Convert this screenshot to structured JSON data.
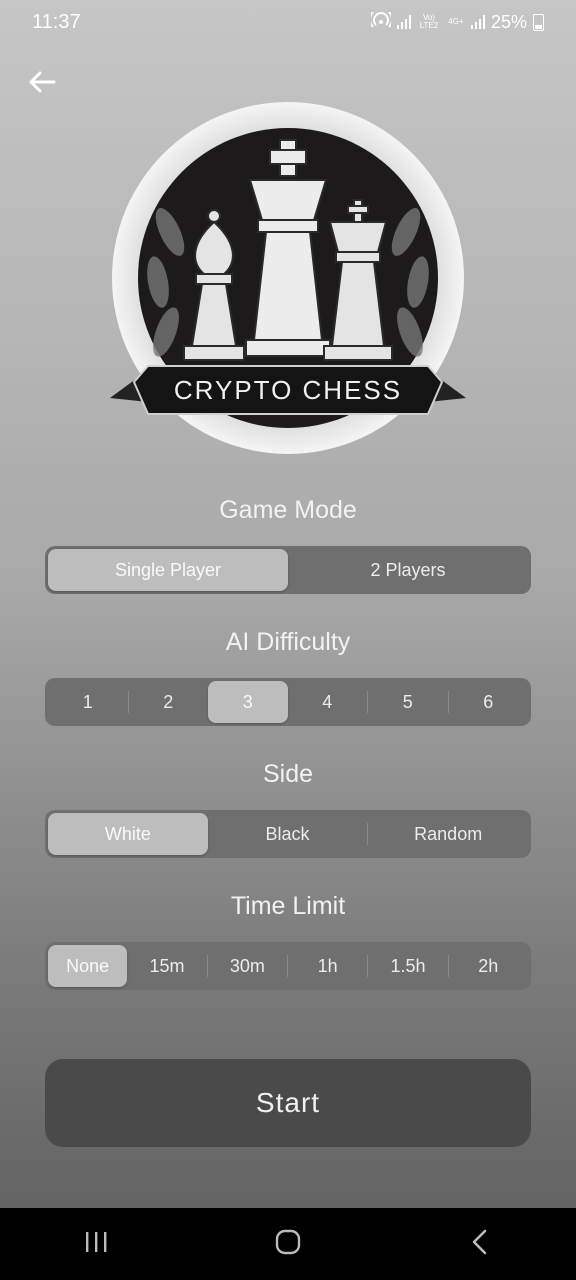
{
  "status_bar": {
    "time": "11:37",
    "network_lte": "Vo) LTE2",
    "network_4g": "4G+",
    "battery": "25%"
  },
  "logo": {
    "text": "CRYPTO CHESS"
  },
  "game_mode": {
    "title": "Game Mode",
    "options": [
      "Single Player",
      "2 Players"
    ],
    "selected": "Single Player"
  },
  "ai_difficulty": {
    "title": "AI Difficulty",
    "options": [
      "1",
      "2",
      "3",
      "4",
      "5",
      "6"
    ],
    "selected": "3"
  },
  "side": {
    "title": "Side",
    "options": [
      "White",
      "Black",
      "Random"
    ],
    "selected": "White"
  },
  "time_limit": {
    "title": "Time Limit",
    "options": [
      "None",
      "15m",
      "30m",
      "1h",
      "1.5h",
      "2h"
    ],
    "selected": "None"
  },
  "start_button": {
    "label": "Start"
  },
  "icons": {
    "back": "arrow-left-icon",
    "recents": "recents-icon",
    "home": "home-icon",
    "nav_back": "chevron-left-icon"
  }
}
